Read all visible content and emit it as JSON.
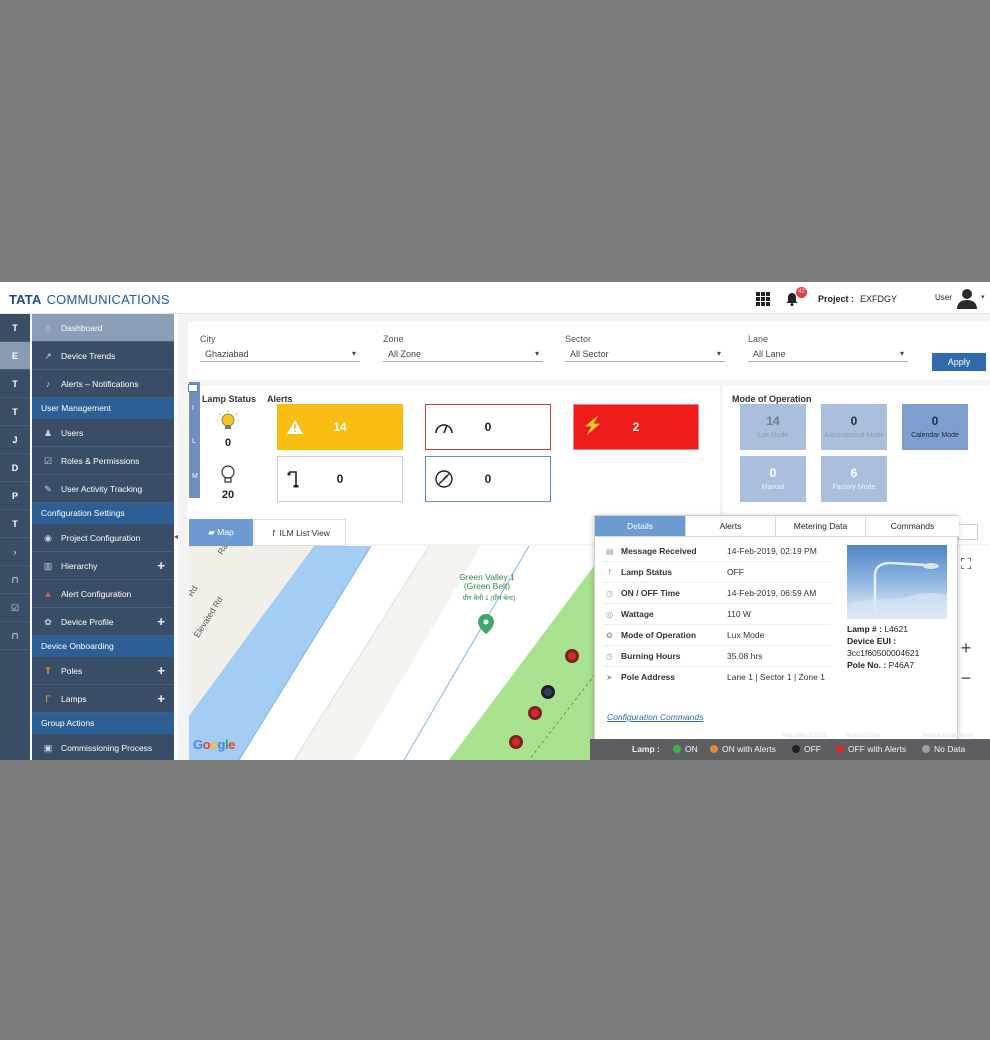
{
  "header": {
    "brand_bold": "TATA",
    "brand_rest": "COMMUNICATIONS",
    "notification_count": "42",
    "project_label": "Project :",
    "project_value": "EXFDGY",
    "user_label": "User"
  },
  "rail": [
    "T",
    "E",
    "T",
    "T",
    "J",
    "D",
    "P",
    "T"
  ],
  "sidebar": {
    "items": [
      {
        "label": "Dashboard",
        "icon": "home-icon"
      },
      {
        "label": "Device Trends",
        "icon": "trend-icon"
      },
      {
        "label": "Alerts – Notifications",
        "icon": "bell-icon"
      }
    ],
    "section_user_management": "User Management",
    "user_items": [
      {
        "label": "Users",
        "icon": "user-icon"
      },
      {
        "label": "Roles & Permissions",
        "icon": "checkbox-icon"
      },
      {
        "label": "User Activity Tracking",
        "icon": "edit-icon"
      }
    ],
    "section_configuration": "Configuration Settings",
    "config_items": [
      {
        "label": "Project Configuration",
        "icon": "eye-icon"
      },
      {
        "label": "Hierarchy",
        "icon": "chart-icon"
      },
      {
        "label": "Alert Configuration",
        "icon": "alert-icon"
      },
      {
        "label": "Device Profile",
        "icon": "gear-icon"
      }
    ],
    "section_device_onboarding": "Device Onboarding",
    "device_items": [
      {
        "label": "Poles",
        "icon": "pole-icon"
      },
      {
        "label": "Lamps",
        "icon": "lamp-icon"
      }
    ],
    "section_group_actions": "Group Actions",
    "group_items": [
      {
        "label": "Commissioning Process",
        "icon": "process-icon"
      }
    ]
  },
  "filters": {
    "city_label": "City",
    "city_value": "Ghaziabad",
    "zone_label": "Zone",
    "zone_value": "All Zone",
    "sector_label": "Sector",
    "sector_value": "All Sector",
    "lane_label": "Lane",
    "lane_value": "All Lane",
    "apply_label": "Apply"
  },
  "strip_letters": [
    "I",
    "L",
    "M"
  ],
  "lamp_status": {
    "title": "Lamp Status",
    "on_count": "0",
    "off_count": "20"
  },
  "alerts": {
    "title": "Alerts",
    "boxes": [
      {
        "value": "14",
        "color": "#f9bd11"
      },
      {
        "value": "0"
      },
      {
        "value": "2",
        "color": "#ef1c1c"
      },
      {
        "value": "0"
      },
      {
        "value": "0"
      }
    ]
  },
  "mode": {
    "title": "Mode of Operation",
    "items": [
      {
        "value": "14",
        "label": "Lux Mode"
      },
      {
        "value": "0",
        "label": "Astronomical Mode"
      },
      {
        "value": "0",
        "label": "Calendar Mode"
      },
      {
        "value": "0",
        "label": "Manual"
      },
      {
        "value": "6",
        "label": "Factory Mode"
      }
    ]
  },
  "map_tabs": {
    "map": "Map",
    "list": "ILM List View"
  },
  "map": {
    "landmark": "Green Valley 1 (Green Belt)",
    "landmark_local": "ग्रीन वैली 1 (ग्रीन बेल्ट)",
    "road_label": "Elevated Rd",
    "road_label2": "Rd",
    "road_label3": "Ra",
    "google": "Google",
    "map_data_text": "Map data ©2019",
    "terms_text": "Terms of Use",
    "report_text": "Report a map error"
  },
  "popup": {
    "tabs": [
      "Details",
      "Alerts",
      "Metering Data",
      "Commands"
    ],
    "rows": [
      {
        "k": "Message Received",
        "v": "14-Feb-2019, 02:19 PM"
      },
      {
        "k": "Lamp Status",
        "v": "OFF"
      },
      {
        "k": "ON / OFF Time",
        "v": "14-Feb-2019, 06:59 AM"
      },
      {
        "k": "Wattage",
        "v": "110 W"
      },
      {
        "k": "Mode of Operation",
        "v": "Lux Mode"
      },
      {
        "k": "Burning Hours",
        "v": "35.08 hrs"
      },
      {
        "k": "Pole Address",
        "v": "Lane 1 | Sector 1 | Zone 1"
      }
    ],
    "config_link": "Configuration Commands",
    "lamp_label": "Lamp # :",
    "lamp_value": "L4621",
    "eui_label": "Device EUI :",
    "eui_value": "3cc1f60500004621",
    "pole_label": "Pole No. :",
    "pole_value": "P46A7"
  },
  "legend": {
    "title": "Lamp :",
    "items": [
      {
        "label": "ON",
        "color": "#38b54a"
      },
      {
        "label": "ON with Alerts",
        "color": "#e8892a"
      },
      {
        "label": "OFF",
        "color": "#222222"
      },
      {
        "label": "OFF with Alerts",
        "color": "#d92b2b"
      },
      {
        "label": "No Data",
        "color": "#9aa0a6"
      }
    ]
  },
  "colors": {
    "nav_dark": "#3a4d67",
    "nav_section": "#2d5f97",
    "accent": "#2f6aad",
    "tab_active": "#6d9bd1"
  }
}
